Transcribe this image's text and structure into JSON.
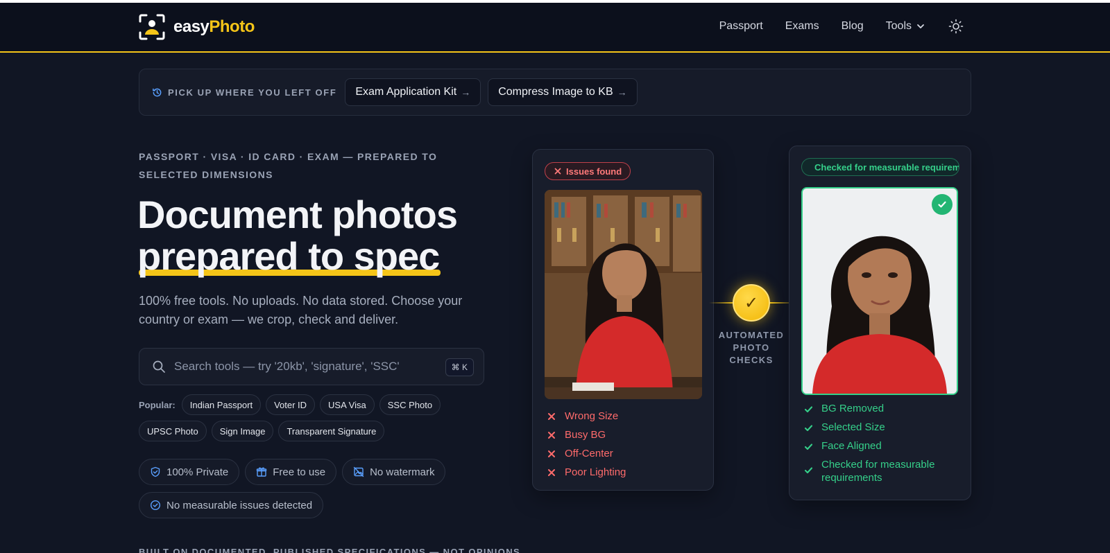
{
  "brand": {
    "name_part1": "easy",
    "name_part2": "Photo",
    "accent": "#f5c518"
  },
  "nav": {
    "links": [
      "Passport",
      "Exams",
      "Blog"
    ],
    "tools_label": "Tools",
    "theme_icon": "sun-icon"
  },
  "resume": {
    "label": "PICK UP WHERE YOU LEFT OFF",
    "chips": [
      {
        "label": "Exam Application Kit",
        "arrow": "→"
      },
      {
        "label": "Compress Image to KB",
        "arrow": "→"
      }
    ]
  },
  "hero": {
    "eyebrow": "PASSPORT · VISA · ID CARD · EXAM — PREPARED TO SELECTED DIMENSIONS",
    "title_line1": "Document photos",
    "title_line2": "prepared to spec",
    "subtitle": "100% free tools. No uploads. No data stored. Choose your country or exam — we crop, check and deliver."
  },
  "search": {
    "placeholder": "Search tools — try '20kb', 'signature', 'SSC'",
    "shortcut": "⌘ K"
  },
  "popular": {
    "label": "Popular:",
    "items": [
      "Indian Passport",
      "Voter ID",
      "USA Visa",
      "SSC Photo",
      "UPSC Photo",
      "Sign Image",
      "Transparent Signature"
    ]
  },
  "badges": [
    "100% Private",
    "Free to use",
    "No watermark",
    "No measurable issues detected"
  ],
  "footer_eyebrow": "BUILT ON DOCUMENTED, PUBLISHED SPECIFICATIONS — NOT OPINIONS",
  "before_card": {
    "tag": "Issues found",
    "issues": [
      "Wrong Size",
      "Busy BG",
      "Off-Center",
      "Poor Lighting"
    ],
    "color": "#ff6b6b"
  },
  "center": {
    "label": "AUTOMATED PHOTO CHECKS",
    "glyph": "✓"
  },
  "after_card": {
    "tag": "Checked for measurable requirements",
    "checks": [
      "BG Removed",
      "Selected Size",
      "Face Aligned",
      "Checked for measurable requirements"
    ],
    "color": "#35d08a"
  }
}
